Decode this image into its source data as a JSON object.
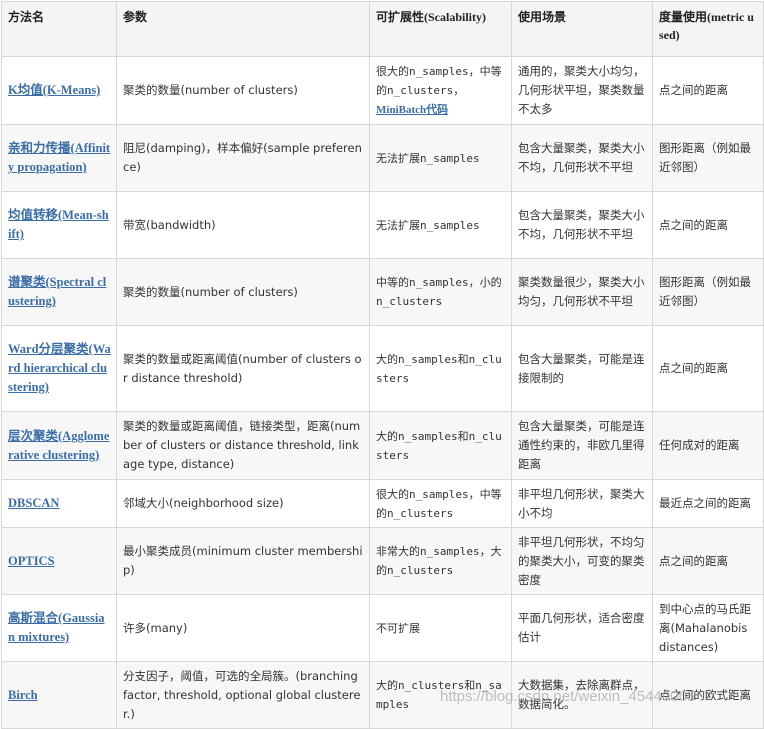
{
  "headers": [
    "方法名",
    "参数",
    "可扩展性(Scalability)",
    "使用场景",
    "度量使用(metric used)"
  ],
  "rows": [
    {
      "method": "K均值(K-Means)",
      "params": "聚类的数量(number of clusters)",
      "scalability": "很大的n_samples，中等的n_clusters，",
      "scalability_link": "MiniBatch代码",
      "usecase": "通用的，聚类大小均匀，几何形状平坦，聚类数量不太多",
      "metric": "点之间的距离"
    },
    {
      "method": "亲和力传播(Affinity propagation)",
      "params": "阻尼(damping)，样本偏好(sample preference)",
      "scalability": "无法扩展n_samples",
      "usecase": "包含大量聚类，聚类大小不均，几何形状不平坦",
      "metric": "图形距离（例如最近邻图）"
    },
    {
      "method": "均值转移(Mean-shift)",
      "params": "带宽(bandwidth)",
      "scalability": "无法扩展n_samples",
      "usecase": "包含大量聚类，聚类大小不均，几何形状不平坦",
      "metric": "点之间的距离"
    },
    {
      "method": "谱聚类(Spectral clustering)",
      "params": "聚类的数量(number of clusters)",
      "scalability": "中等的n_samples，小的n_clusters",
      "usecase": "聚类数量很少，聚类大小均匀，几何形状不平坦",
      "metric": "图形距离（例如最近邻图）"
    },
    {
      "method": "Ward分层聚类(Ward hierarchical clustering)",
      "params": "聚类的数量或距离阈值(number of clusters or distance threshold)",
      "scalability": "大的n_samples和n_clusters",
      "usecase": "包含大量聚类，可能是连接限制的",
      "metric": "点之间的距离"
    },
    {
      "method": "层次聚类(Agglomerative clustering)",
      "params": "聚类的数量或距离阈值，链接类型，距离(number of clusters or distance threshold, linkage type, distance)",
      "scalability": "大的n_samples和n_clusters",
      "usecase": "包含大量聚类，可能是连通性约束的，非欧几里得距离",
      "metric": "任何成对的距离"
    },
    {
      "method": "DBSCAN",
      "params": "邻域大小(neighborhood size)",
      "scalability": "很大的n_samples，中等的n_clusters",
      "usecase": "非平坦几何形状，聚类大小不均",
      "metric": "最近点之间的距离"
    },
    {
      "method": "OPTICS",
      "params": "最小聚类成员(minimum cluster membership)",
      "scalability": "非常大的n_samples，大的n_clusters",
      "usecase": "非平坦几何形状，不均匀的聚类大小，可变的聚类密度",
      "metric": "点之间的距离"
    },
    {
      "method": "高斯混合(Gaussian mixtures)",
      "params": "许多(many)",
      "scalability": "不可扩展",
      "usecase": "平面几何形状，适合密度估计",
      "metric": "到中心点的马氏距离(Mahalanobis distances)"
    },
    {
      "method": "Birch",
      "params": "分支因子，阈值，可选的全局簇。(branching factor, threshold, optional global clusterer.)",
      "scalability": "大的n_clusters和n_samples",
      "usecase": "大数据集，去除离群点，数据简化。",
      "metric": "点之间的欧式距离"
    }
  ],
  "watermark": "https://blog.csdn.net/weixin_45440065"
}
